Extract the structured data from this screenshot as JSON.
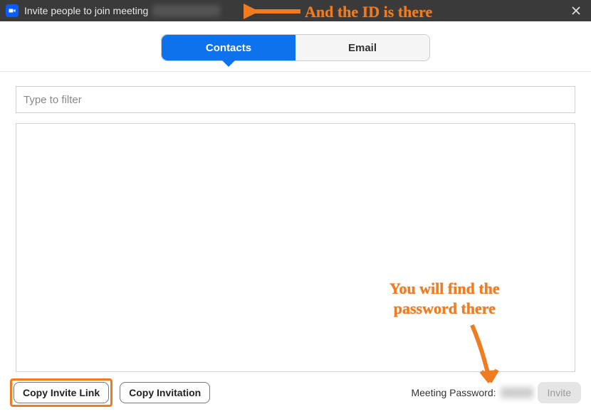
{
  "titlebar": {
    "title": "Invite people to join meeting"
  },
  "tabs": {
    "contacts": "Contacts",
    "email": "Email"
  },
  "filter": {
    "placeholder": "Type to filter"
  },
  "footer": {
    "copy_link": "Copy Invite Link",
    "copy_invitation": "Copy Invitation",
    "password_label": "Meeting Password:",
    "invite": "Invite"
  },
  "annotations": {
    "id_note": "And the ID is there",
    "pw_note_line1": "You will find the",
    "pw_note_line2": "password there"
  }
}
